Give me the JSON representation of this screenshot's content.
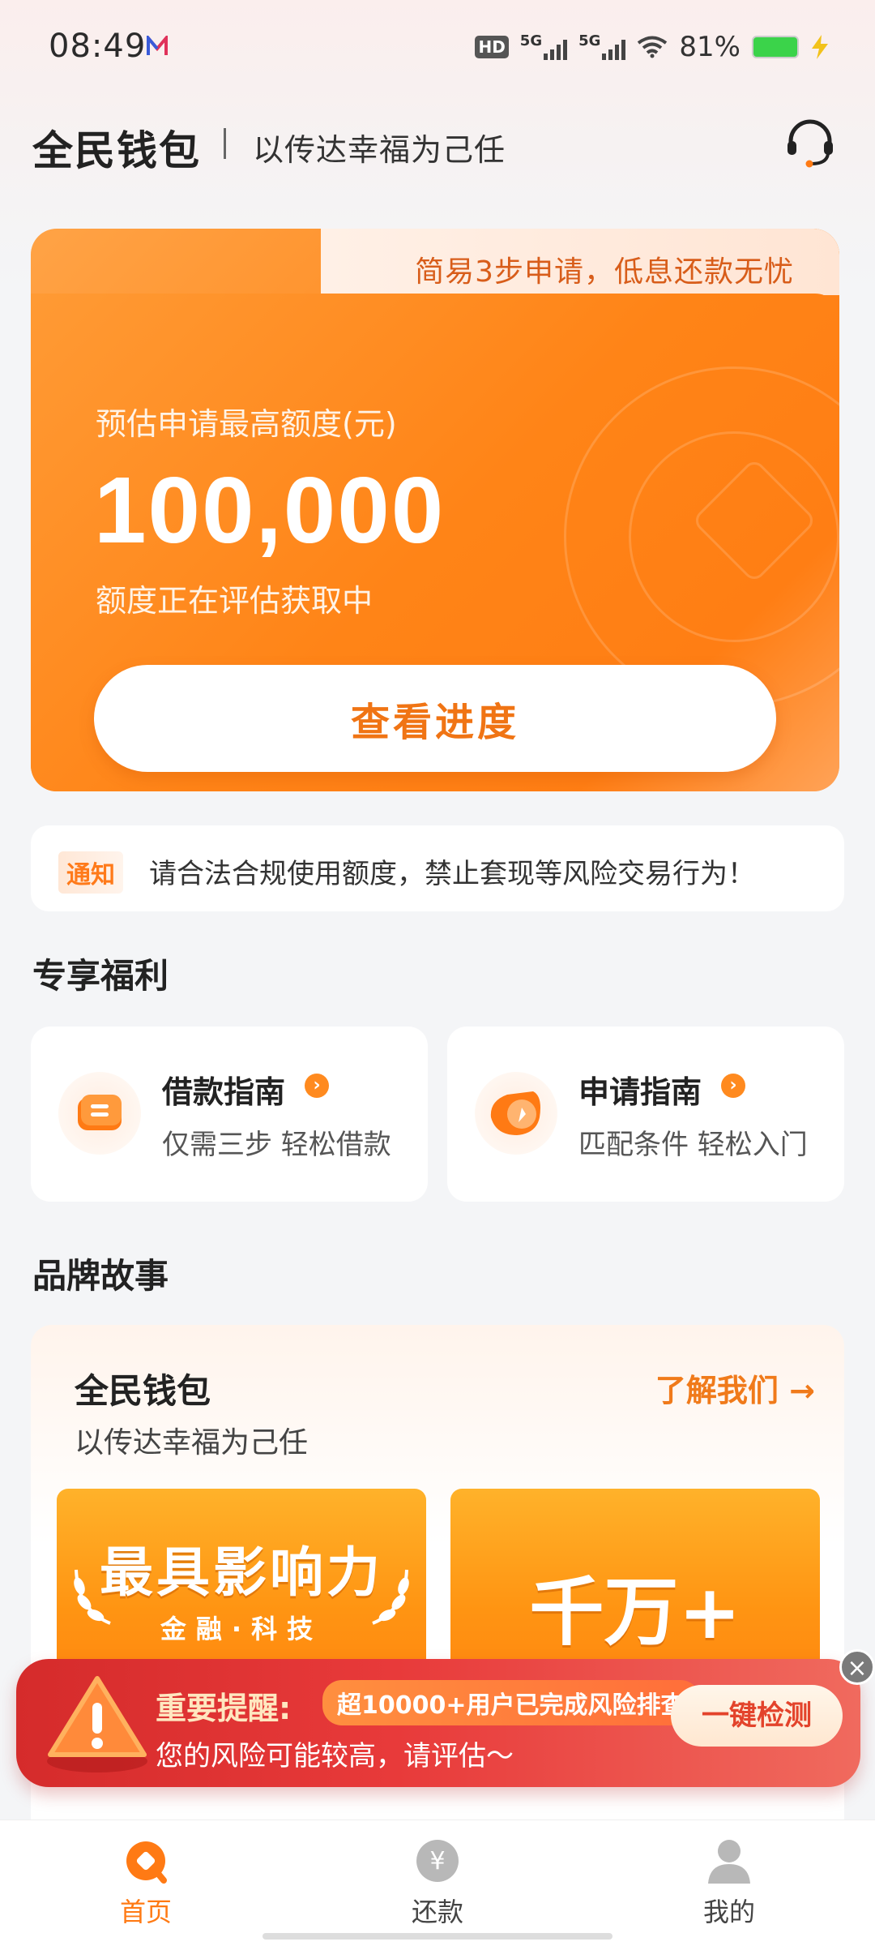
{
  "status_bar": {
    "time": "08:49",
    "hd": "HD",
    "net1": "5G",
    "net2": "5G",
    "battery": "81%"
  },
  "header": {
    "brand": "全民钱包",
    "slogan": "以传达幸福为己任"
  },
  "hero": {
    "tab_text": "简易3步申请，低息还款无忧",
    "label": "预估申请最高额度(元)",
    "amount": "100,000",
    "sub": "额度正在评估获取中",
    "button": "查看进度"
  },
  "notice": {
    "tag": "通知",
    "text": "请合法合规使用额度，禁止套现等风险交易行为！"
  },
  "benefits": {
    "title": "专享福利",
    "items": [
      {
        "title": "借款指南",
        "desc": "仅需三步 轻松借款"
      },
      {
        "title": "申请指南",
        "desc": "匹配条件 轻松入门"
      }
    ]
  },
  "story": {
    "section_title": "品牌故事",
    "title": "全民钱包",
    "sub": "以传达幸福为己任",
    "link": "了解我们 →",
    "card1_big": "最具影响力",
    "card1_small": "金融·科技",
    "card2": "千万+"
  },
  "risk": {
    "title": "重要提醒:",
    "pill": "超10000+用户已完成风险排查",
    "desc": "您的风险可能较高，请评估～",
    "button": "一键检测",
    "close": "×"
  },
  "tabbar": {
    "items": [
      {
        "label": "首页",
        "icon": "home-icon",
        "active": true
      },
      {
        "label": "还款",
        "icon": "repay-icon",
        "active": false
      },
      {
        "label": "我的",
        "icon": "profile-icon",
        "active": false
      }
    ]
  },
  "colors": {
    "accent": "#ff7a14",
    "risk_red": "#e03636"
  }
}
